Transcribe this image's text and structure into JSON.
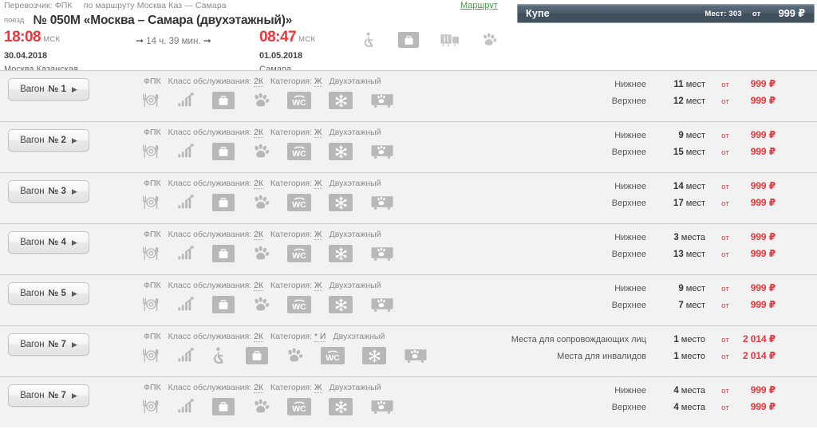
{
  "header": {
    "carrier_label": "Перевозчик:",
    "carrier_name": "ФПК",
    "route_prefix": "по маршруту",
    "route_text": "Москва Каз — Самара",
    "route_link": "Маршрут",
    "train_label": "поезд",
    "train_number_title": "№ 050М «Москва – Самара (двухэтажный)»",
    "departure": {
      "time": "18:08",
      "zone": "МСК",
      "date": "30.04.2018",
      "station": "Москва Казанская"
    },
    "arrival": {
      "time": "08:47",
      "zone": "МСК",
      "date": "01.05.2018",
      "station": "Самара"
    },
    "duration": "14 ч. 39 мин.",
    "facility_icons": [
      "wheelchair-icon",
      "luggage-icon",
      "train-car-icon",
      "paw-icon"
    ]
  },
  "category_bar": {
    "name": "Купе",
    "seats_label": "Мест: 303",
    "from_label": "от",
    "price": "999 ₽"
  },
  "labels": {
    "wagon": "Вагон",
    "number_sign": "№",
    "carrier_short": "ФПК",
    "service_class_label": "Класс обслуживания:",
    "category_label": "Категория:",
    "double_decker": "Двухэтажный",
    "from": "от"
  },
  "colors": {
    "accent_red": "#e8383d",
    "bar_dark": "#4a5a69",
    "link_green": "#4b9b4b",
    "row_bg": "#f2f2f2",
    "icon_grey": "#b8b8b8"
  },
  "wagons": [
    {
      "number": "1",
      "service_class": "2К",
      "category": "Ж",
      "double_decker": "Двухэтажный",
      "icons": [
        "restaurant-icon",
        "wifi-icon",
        "luggage-icon",
        "paw-icon",
        "wc-icon",
        "air-conditioning-icon",
        "pet-carriage-icon"
      ],
      "seats": [
        {
          "label": "Нижнее",
          "count": "11",
          "unit": "мест",
          "from": "от",
          "price": "999 ₽"
        },
        {
          "label": "Верхнее",
          "count": "12",
          "unit": "мест",
          "from": "от",
          "price": "999 ₽"
        }
      ]
    },
    {
      "number": "2",
      "service_class": "2К",
      "category": "Ж",
      "double_decker": "Двухэтажный",
      "icons": [
        "restaurant-icon",
        "wifi-icon",
        "luggage-icon",
        "paw-icon",
        "wc-icon",
        "air-conditioning-icon",
        "pet-carriage-icon"
      ],
      "seats": [
        {
          "label": "Нижнее",
          "count": "9",
          "unit": "мест",
          "from": "от",
          "price": "999 ₽"
        },
        {
          "label": "Верхнее",
          "count": "15",
          "unit": "мест",
          "from": "от",
          "price": "999 ₽"
        }
      ]
    },
    {
      "number": "3",
      "service_class": "2К",
      "category": "Ж",
      "double_decker": "Двухэтажный",
      "icons": [
        "restaurant-icon",
        "wifi-icon",
        "luggage-icon",
        "paw-icon",
        "wc-icon",
        "air-conditioning-icon",
        "pet-carriage-icon"
      ],
      "seats": [
        {
          "label": "Нижнее",
          "count": "14",
          "unit": "мест",
          "from": "от",
          "price": "999 ₽"
        },
        {
          "label": "Верхнее",
          "count": "17",
          "unit": "мест",
          "from": "от",
          "price": "999 ₽"
        }
      ]
    },
    {
      "number": "4",
      "service_class": "2К",
      "category": "Ж",
      "double_decker": "Двухэтажный",
      "icons": [
        "restaurant-icon",
        "wifi-icon",
        "luggage-icon",
        "paw-icon",
        "wc-icon",
        "air-conditioning-icon",
        "pet-carriage-icon"
      ],
      "seats": [
        {
          "label": "Нижнее",
          "count": "3",
          "unit": "места",
          "from": "от",
          "price": "999 ₽"
        },
        {
          "label": "Верхнее",
          "count": "13",
          "unit": "мест",
          "from": "от",
          "price": "999 ₽"
        }
      ]
    },
    {
      "number": "5",
      "service_class": "2К",
      "category": "Ж",
      "double_decker": "Двухэтажный",
      "icons": [
        "restaurant-icon",
        "wifi-icon",
        "luggage-icon",
        "paw-icon",
        "wc-icon",
        "air-conditioning-icon",
        "pet-carriage-icon"
      ],
      "seats": [
        {
          "label": "Нижнее",
          "count": "9",
          "unit": "мест",
          "from": "от",
          "price": "999 ₽"
        },
        {
          "label": "Верхнее",
          "count": "7",
          "unit": "мест",
          "from": "от",
          "price": "999 ₽"
        }
      ]
    },
    {
      "number": "7",
      "service_class": "2К",
      "category": "* И",
      "double_decker": "Двухэтажный",
      "icons": [
        "restaurant-icon",
        "wifi-icon",
        "wheelchair-icon",
        "luggage-icon",
        "paw-icon",
        "wc-icon",
        "air-conditioning-icon",
        "pet-carriage-icon"
      ],
      "seats": [
        {
          "label": "Места для сопровождающих лиц",
          "count": "1",
          "unit": "место",
          "from": "от",
          "price": "2 014 ₽"
        },
        {
          "label": "Места для инвалидов",
          "count": "1",
          "unit": "место",
          "from": "от",
          "price": "2 014 ₽"
        }
      ]
    },
    {
      "number": "7",
      "service_class": "2К",
      "category": "Ж",
      "double_decker": "Двухэтажный",
      "icons": [
        "restaurant-icon",
        "wifi-icon",
        "luggage-icon",
        "paw-icon",
        "wc-icon",
        "air-conditioning-icon",
        "pet-carriage-icon"
      ],
      "seats": [
        {
          "label": "Нижнее",
          "count": "4",
          "unit": "места",
          "from": "от",
          "price": "999 ₽"
        },
        {
          "label": "Верхнее",
          "count": "4",
          "unit": "места",
          "from": "от",
          "price": "999 ₽"
        }
      ]
    }
  ]
}
